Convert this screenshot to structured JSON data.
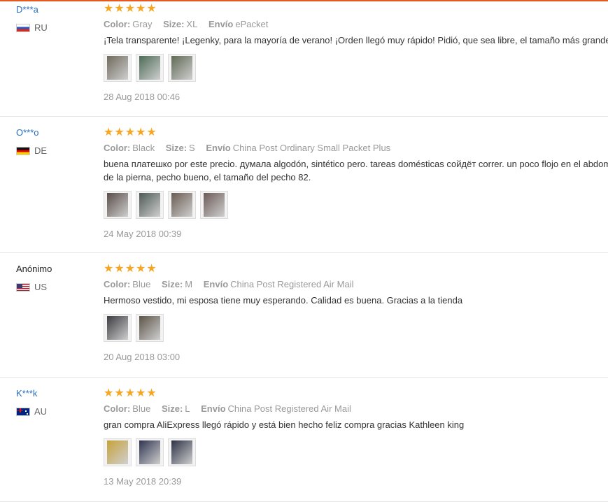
{
  "reviews": [
    {
      "user": "D***a",
      "country": "RU",
      "flag": "russia-flag",
      "stars": "★★★★★",
      "attrs": [
        {
          "k": "Color:",
          "v": "Gray"
        },
        {
          "k": "Size:",
          "v": "XL"
        },
        {
          "k": "Envío",
          "v": "ePacket"
        }
      ],
      "text": "¡Tela transparente! ¡Legenky, para la mayoría de verano! ¡Orden llegó muy rápido! Pidió, que sea libre, el tamaño más grande",
      "thumb_colors": [
        "#6f6a5c",
        "#4d6b57",
        "#5f6a54"
      ],
      "date": "28 Aug 2018 00:46"
    },
    {
      "user": "O***o",
      "country": "DE",
      "flag": "germany-flag",
      "stars": "★★★★★",
      "attrs": [
        {
          "k": "Color:",
          "v": "Black"
        },
        {
          "k": "Size:",
          "v": "S"
        },
        {
          "k": "Envío",
          "v": "China Post Ordinary Small Packet Plus"
        }
      ],
      "text": "buena платешко por este precio. думала algodón, sintético pero. tareas domésticas сойдёт correr. un poco flojo en el abdomen\nde la pierna, pecho bueno, el tamaño del pecho 82.",
      "thumb_colors": [
        "#5a4e4a",
        "#4e5a55",
        "#6a5c52",
        "#6c5a58"
      ],
      "date": "24 May 2018 00:39"
    },
    {
      "user": "Anónimo",
      "country": "US",
      "flag": "usa-flag",
      "stars": "★★★★★",
      "attrs": [
        {
          "k": "Color:",
          "v": "Blue"
        },
        {
          "k": "Size:",
          "v": "M"
        },
        {
          "k": "Envío",
          "v": "China Post Registered Air Mail"
        }
      ],
      "text": "Hermoso vestido, mi esposa tiene muy esperando. Calidad es buena. Gracias a la tienda",
      "thumb_colors": [
        "#3b3b42",
        "#5c5447"
      ],
      "date": "20 Aug 2018 03:00"
    },
    {
      "user": "K***k",
      "country": "AU",
      "flag": "australia-flag",
      "stars": "★★★★★",
      "attrs": [
        {
          "k": "Color:",
          "v": "Blue"
        },
        {
          "k": "Size:",
          "v": "L"
        },
        {
          "k": "Envío",
          "v": "China Post Registered Air Mail"
        }
      ],
      "text": "gran compra AliExpress llegó rápido y está bien hecho feliz compra gracias Kathleen king",
      "thumb_colors": [
        "#c7a23a",
        "#2f3550",
        "#2c3145"
      ],
      "date": "13 May 2018 20:39"
    }
  ]
}
